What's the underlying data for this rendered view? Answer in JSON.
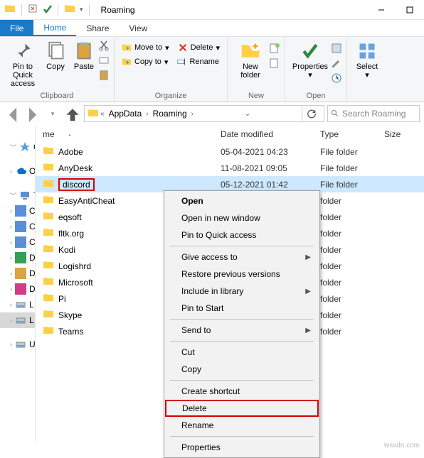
{
  "window": {
    "title": "Roaming"
  },
  "tabs": {
    "file": "File",
    "home": "Home",
    "share": "Share",
    "view": "View"
  },
  "ribbon": {
    "pin": "Pin to Quick access",
    "copy": "Copy",
    "paste": "Paste",
    "moveto": "Move to",
    "copyto": "Copy to",
    "delete": "Delete",
    "rename": "Rename",
    "newfolder": "New folder",
    "properties": "Properties",
    "select": "Select",
    "grp_clipboard": "Clipboard",
    "grp_organize": "Organize",
    "grp_new": "New",
    "grp_open": "Open"
  },
  "breadcrumb": {
    "p1": "AppData",
    "p2": "Roaming"
  },
  "search": {
    "placeholder": "Search Roaming"
  },
  "columns": {
    "name": "me",
    "date": "Date modified",
    "type": "Type",
    "size": "Size"
  },
  "rows": [
    {
      "name": "Adobe",
      "date": "05-04-2021 04:23",
      "type": "File folder"
    },
    {
      "name": "AnyDesk",
      "date": "11-08-2021 09:05",
      "type": "File folder"
    },
    {
      "name": "discord",
      "date": "05-12-2021 01:42",
      "type": "File folder"
    },
    {
      "name": "EasyAntiCheat",
      "date": "",
      "type": "folder"
    },
    {
      "name": "eqsoft",
      "date": "",
      "type": "folder"
    },
    {
      "name": "fltk.org",
      "date": "",
      "type": "folder"
    },
    {
      "name": "Kodi",
      "date": "",
      "type": "folder"
    },
    {
      "name": "Logishrd",
      "date": "",
      "type": "folder"
    },
    {
      "name": "Microsoft",
      "date": "",
      "type": "folder"
    },
    {
      "name": "Pi",
      "date": "",
      "type": "folder"
    },
    {
      "name": "Skype",
      "date": "",
      "type": "folder"
    },
    {
      "name": "Teams",
      "date": "",
      "type": "folder"
    }
  ],
  "nav": [
    "Qu",
    "O",
    "Th",
    "C",
    "C",
    "C",
    "D",
    "D",
    "D",
    "L",
    "L",
    "U"
  ],
  "ctx": {
    "open": "Open",
    "opennew": "Open in new window",
    "pin": "Pin to Quick access",
    "give": "Give access to",
    "restore": "Restore previous versions",
    "include": "Include in library",
    "pinstart": "Pin to Start",
    "sendto": "Send to",
    "cut": "Cut",
    "copy": "Copy",
    "shortcut": "Create shortcut",
    "delete": "Delete",
    "rename": "Rename",
    "props": "Properties"
  },
  "watermark": "wsxdn.com"
}
